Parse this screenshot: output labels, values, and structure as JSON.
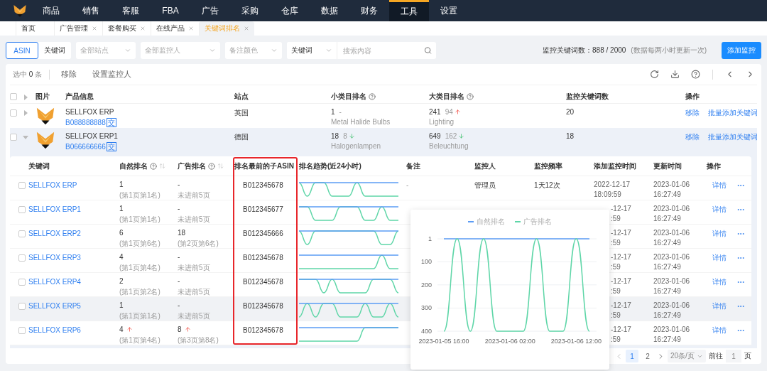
{
  "nav": {
    "items": [
      {
        "label": "商品",
        "selected": false
      },
      {
        "label": "销售",
        "selected": false
      },
      {
        "label": "客服",
        "selected": false
      },
      {
        "label": "FBA",
        "selected": false
      },
      {
        "label": "广告",
        "selected": false
      },
      {
        "label": "采购",
        "selected": false
      },
      {
        "label": "仓库",
        "selected": false
      },
      {
        "label": "数据",
        "selected": false
      },
      {
        "label": "财务",
        "selected": false
      },
      {
        "label": "工具",
        "selected": true
      },
      {
        "label": "设置",
        "selected": false
      }
    ]
  },
  "tabs": [
    {
      "label": "首页",
      "closable": false,
      "selected": false
    },
    {
      "label": "广告管理",
      "closable": true,
      "selected": false
    },
    {
      "label": "套餐购买",
      "closable": true,
      "selected": false
    },
    {
      "label": "在线产品",
      "closable": true,
      "selected": false
    },
    {
      "label": "关键词排名",
      "closable": true,
      "selected": true
    }
  ],
  "filters": {
    "modes": [
      {
        "label": "ASIN",
        "selected": true
      },
      {
        "label": "关键词",
        "selected": false
      }
    ],
    "dropdowns": [
      {
        "placeholder": "全部站点"
      },
      {
        "placeholder": "全部监控人"
      },
      {
        "placeholder": "备注颜色"
      }
    ],
    "search_type": "关键词",
    "search": {
      "placeholder": "搜索内容"
    },
    "quota": "监控关键词数：888 / 2000",
    "quota_note": "(数据每两小时更新一次)",
    "add_button": "添加监控"
  },
  "toolbar": {
    "selected_count": "选中 **0** 条",
    "actions": [
      "移除",
      "设置监控人"
    ]
  },
  "table": {
    "all_checked": false,
    "columns": [
      {
        "label": "图片",
        "help": false
      },
      {
        "label": "产品信息",
        "help": false
      },
      {
        "label": "站点",
        "help": false
      },
      {
        "label": "小类目排名",
        "help": true
      },
      {
        "label": "大类目排名",
        "help": true
      },
      {
        "label": "监控关键词数",
        "help": false
      },
      {
        "label": "操作",
        "help": false
      }
    ],
    "rows": [
      {
        "checked": false,
        "expanded": false,
        "name": "SELLFOX ERP",
        "asin": "B088888888",
        "badge": "交",
        "site": "英国",
        "sub_rank": {
          "value": "1",
          "change": "-",
          "rising": false,
          "falling": false,
          "category": "Metal Halide Bulbs"
        },
        "main_rank": {
          "value": "241",
          "change": "94",
          "rising": true,
          "falling": false,
          "category": "Lighting"
        },
        "keyword_count": "20",
        "actions": [
          "移除",
          "批量添加关键词"
        ]
      },
      {
        "checked": false,
        "expanded": true,
        "name": "SELLFOX ERP1",
        "asin": "B066666666",
        "badge": "交",
        "site": "德国",
        "sub_rank": {
          "value": "18",
          "change": "8",
          "rising": false,
          "falling": true,
          "category": "Halogenlampen"
        },
        "main_rank": {
          "value": "649",
          "change": "162",
          "rising": false,
          "falling": true,
          "category": "Beleuchtung"
        },
        "keyword_count": "18",
        "actions": [
          "移除",
          "批量添加关键词"
        ]
      }
    ]
  },
  "sub_table": {
    "columns": [
      {
        "label": "关键词",
        "help": false,
        "sortable": false,
        "highlighted": false
      },
      {
        "label": "自然排名",
        "help": true,
        "sortable": true,
        "highlighted": false
      },
      {
        "label": "广告排名",
        "help": true,
        "sortable": true,
        "highlighted": false
      },
      {
        "label": "排名最前的子ASIN",
        "help": false,
        "sortable": false,
        "highlighted": true
      },
      {
        "label": "排名趋势(近24小时)",
        "help": false,
        "sortable": false,
        "highlighted": false
      },
      {
        "label": "备注",
        "help": false,
        "sortable": false,
        "highlighted": false
      },
      {
        "label": "监控人",
        "help": false,
        "sortable": false,
        "highlighted": false
      },
      {
        "label": "监控频率",
        "help": false,
        "sortable": false,
        "highlighted": false
      },
      {
        "label": "添加监控时间",
        "help": false,
        "sortable": false,
        "highlighted": false
      },
      {
        "label": "更新时间",
        "help": false,
        "sortable": false,
        "highlighted": false
      },
      {
        "label": "操作",
        "help": false,
        "sortable": false,
        "highlighted": false
      }
    ],
    "rows": [
      {
        "checked": false,
        "hovered": false,
        "covered": false,
        "keyword": "SELLFOX ERP",
        "natural": {
          "value": "1",
          "rising": false,
          "falling": false,
          "detail": "(第1页第1名)"
        },
        "ad": {
          "value": "-",
          "rising": false,
          "falling": false,
          "detail": "未进前5页"
        },
        "asin": "B012345678",
        "note": "-",
        "monitor": "管理员",
        "frequency": "1天12次",
        "added": [
          "2022-12-17",
          "18:09:59"
        ],
        "updated": [
          "2023-01-06",
          "16:27:49"
        ],
        "action": "详情"
      },
      {
        "checked": false,
        "hovered": false,
        "covered": true,
        "keyword": "SELLFOX ERP1",
        "natural": {
          "value": "1",
          "rising": false,
          "falling": false,
          "detail": "(第1页第1名)"
        },
        "ad": {
          "value": "-",
          "rising": false,
          "falling": false,
          "detail": "未进前5页"
        },
        "asin": "B012345677",
        "added": [
          "-12-17",
          ":59"
        ],
        "updated": [
          "2023-01-06",
          "16:27:49"
        ],
        "action": "详情"
      },
      {
        "checked": false,
        "hovered": false,
        "covered": true,
        "keyword": "SELLFOX ERP2",
        "natural": {
          "value": "6",
          "rising": false,
          "falling": false,
          "detail": "(第1页第6名)"
        },
        "ad": {
          "value": "18",
          "rising": false,
          "falling": false,
          "detail": "(第2页第6名)"
        },
        "asin": "B012345666",
        "added": [
          "-12-17",
          ":59"
        ],
        "updated": [
          "2023-01-06",
          "16:27:49"
        ],
        "action": "详情"
      },
      {
        "checked": false,
        "hovered": false,
        "covered": true,
        "keyword": "SELLFOX ERP3",
        "natural": {
          "value": "4",
          "rising": false,
          "falling": false,
          "detail": "(第1页第4名)"
        },
        "ad": {
          "value": "-",
          "rising": false,
          "falling": false,
          "detail": "未进前5页"
        },
        "asin": "B012345678",
        "added": [
          "-12-17",
          ":59"
        ],
        "updated": [
          "2023-01-06",
          "16:27:49"
        ],
        "action": "详情"
      },
      {
        "checked": false,
        "hovered": false,
        "covered": true,
        "keyword": "SELLFOX ERP4",
        "natural": {
          "value": "2",
          "rising": false,
          "falling": false,
          "detail": "(第1页第2名)"
        },
        "ad": {
          "value": "-",
          "rising": false,
          "falling": false,
          "detail": "未进前5页"
        },
        "asin": "B012345678",
        "added": [
          "-12-17",
          ":59"
        ],
        "updated": [
          "2023-01-06",
          "16:27:49"
        ],
        "action": "详情"
      },
      {
        "checked": false,
        "hovered": true,
        "covered": true,
        "keyword": "SELLFOX ERP5",
        "natural": {
          "value": "1",
          "rising": false,
          "falling": false,
          "detail": "(第1页第1名)"
        },
        "ad": {
          "value": "-",
          "rising": false,
          "falling": false,
          "detail": "未进前5页"
        },
        "asin": "B012345678",
        "added": [
          "-12-17",
          ":59"
        ],
        "updated": [
          "2023-01-06",
          "16:27:49"
        ],
        "action": "详情"
      },
      {
        "checked": false,
        "hovered": false,
        "covered": true,
        "keyword": "SELLFOX ERP6",
        "natural": {
          "value": "4",
          "rising": true,
          "falling": false,
          "detail": "(第1页第4名)"
        },
        "ad": {
          "value": "8",
          "rising": true,
          "falling": false,
          "detail": "(第3页第8名)"
        },
        "asin": "B012345678",
        "added": [
          "-12-17",
          ":59"
        ],
        "updated": [
          "2023-01-06",
          "16:27:49"
        ],
        "action": "详情"
      }
    ]
  },
  "rank_popup": {
    "chart_data": {
      "type": "line",
      "legend": "top",
      "grid": true,
      "categories": [
        "2023-01-05 16:00",
        null,
        null,
        null,
        null,
        "2023-01-06 02:00",
        null,
        null,
        null,
        null,
        "2023-01-06 12:00",
        null
      ],
      "ylim": [
        400,
        1
      ],
      "yticks": [
        1,
        100,
        200,
        300,
        400
      ],
      "series": [
        {
          "name": "自然排名",
          "color": "#5b9cf5",
          "values": [
            1,
            1,
            1,
            1,
            1,
            1,
            1,
            1,
            1,
            1,
            1,
            1
          ]
        },
        {
          "name": "广告排名",
          "color": "#5fd6a8",
          "values": [
            400,
            1,
            400,
            1,
            400,
            400,
            400,
            1,
            400,
            400,
            1,
            400
          ]
        }
      ]
    }
  },
  "pagination": {
    "pages": [
      {
        "label": "1",
        "selected": true
      },
      {
        "label": "2",
        "selected": false
      }
    ],
    "page_size": "20条/页",
    "goto_label": "前往",
    "goto_value": "1",
    "goto_suffix": "页"
  }
}
